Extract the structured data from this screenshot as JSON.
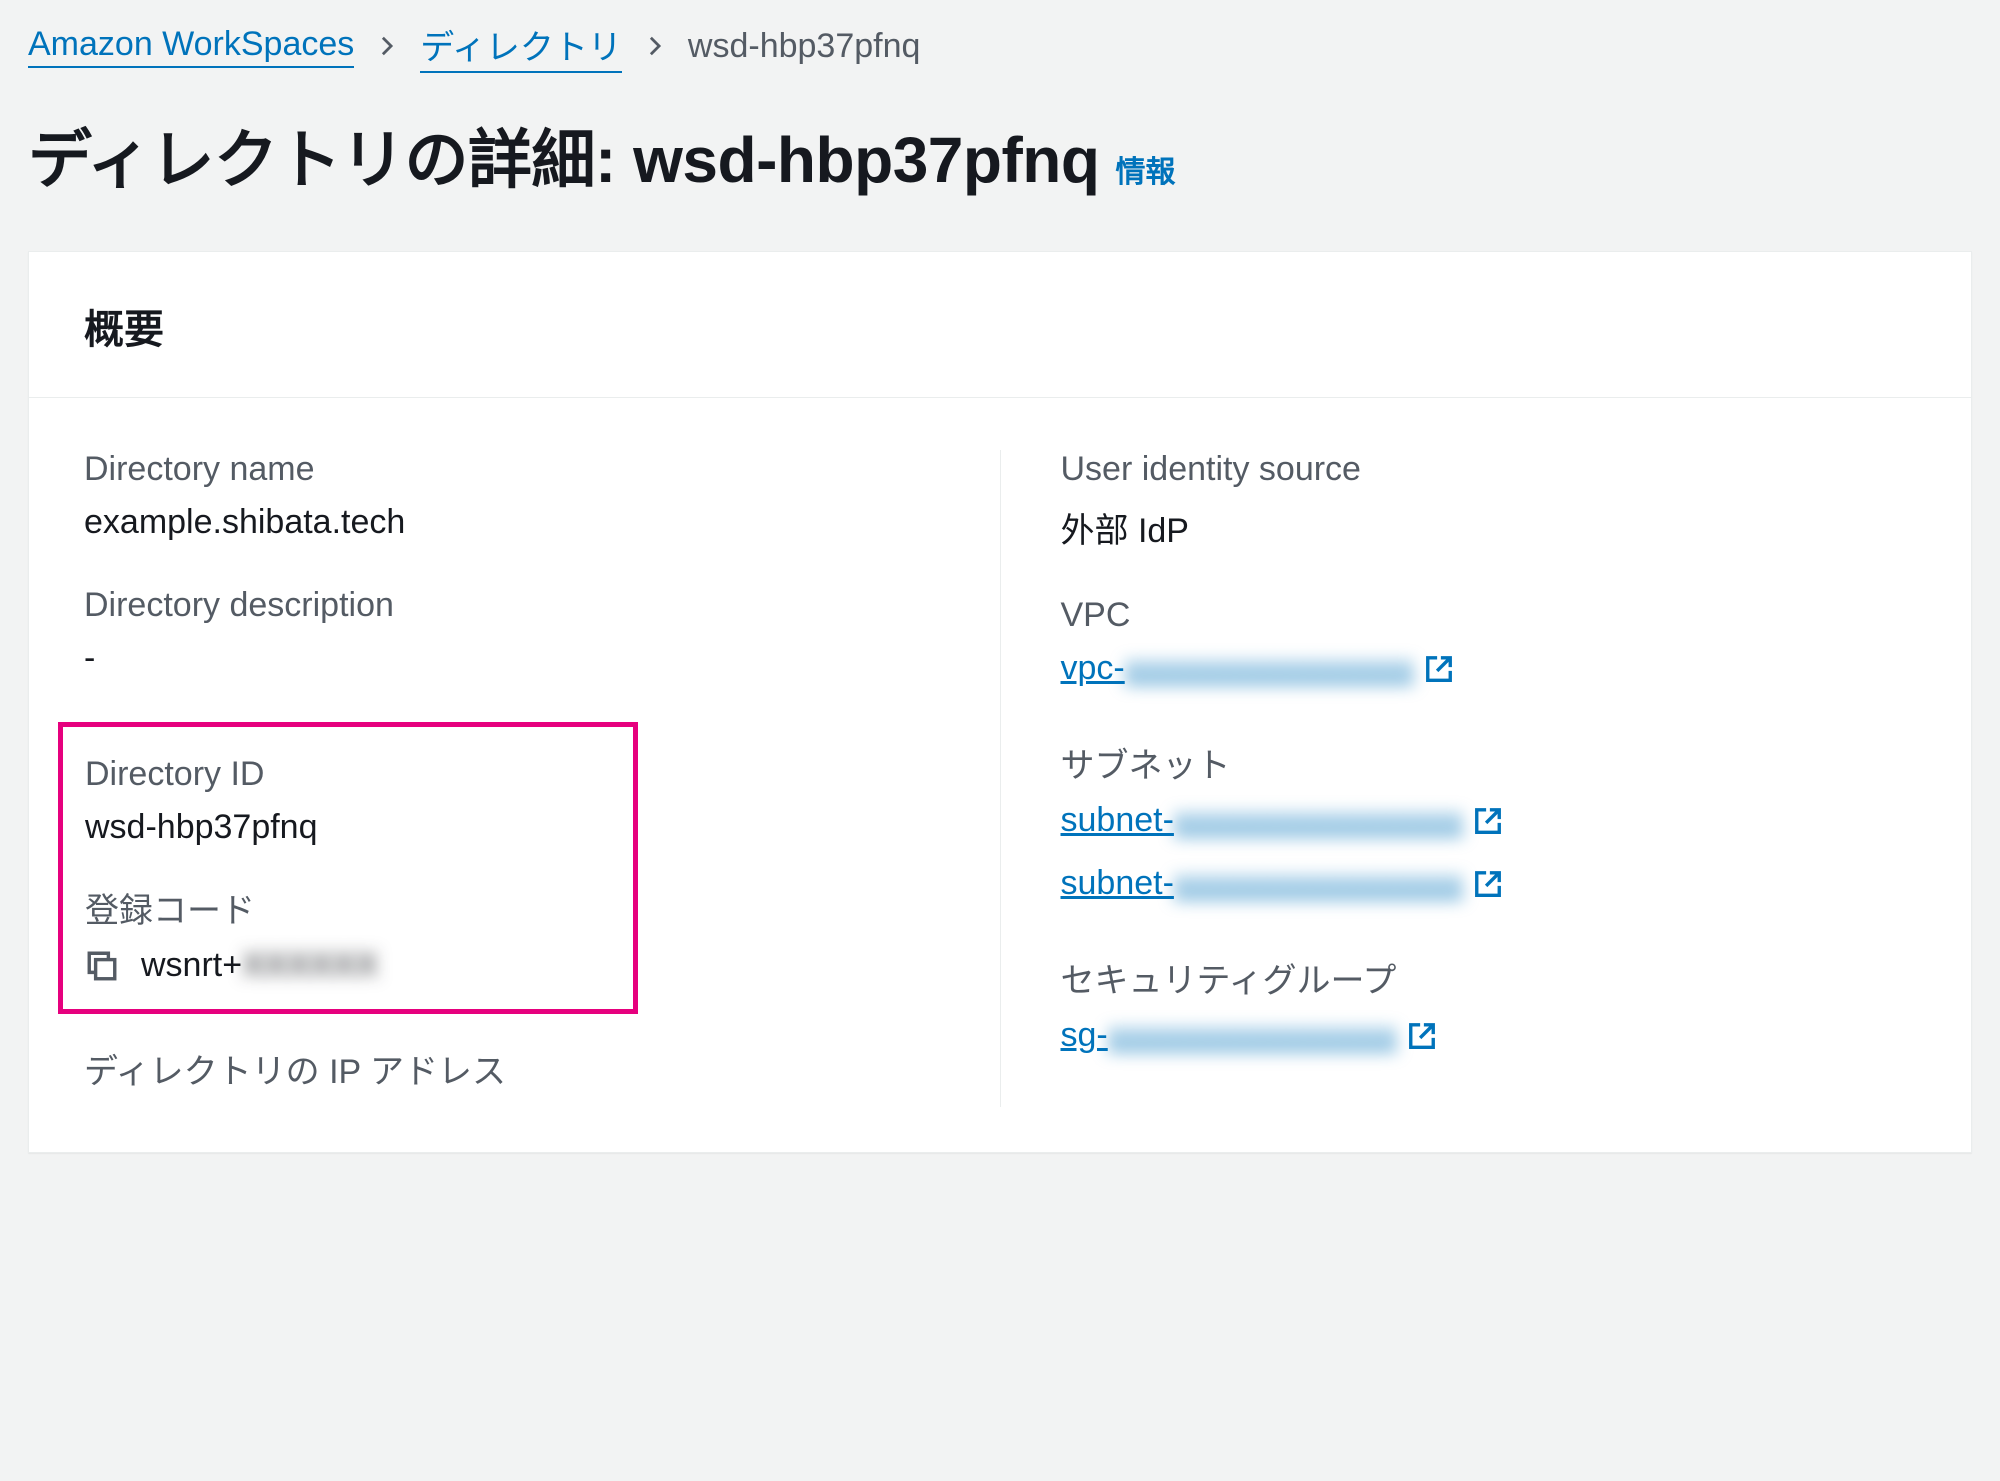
{
  "breadcrumb": {
    "root": "Amazon WorkSpaces",
    "level1": "ディレクトリ",
    "current": "wsd-hbp37pfnq"
  },
  "title": {
    "prefix": "ディレクトリの詳細: ",
    "id": "wsd-hbp37pfnq",
    "info": "情報"
  },
  "panel": {
    "heading": "概要"
  },
  "left": {
    "dir_name_label": "Directory name",
    "dir_name_value": "example.shibata.tech",
    "dir_desc_label": "Directory description",
    "dir_desc_value": "-",
    "dir_id_label": "Directory ID",
    "dir_id_value": "wsd-hbp37pfnq",
    "reg_code_label": "登録コード",
    "reg_code_prefix": "wsnrt+",
    "reg_code_hidden": "XXXXXX",
    "dir_ip_label": "ディレクトリの IP アドレス"
  },
  "right": {
    "uis_label": "User identity source",
    "uis_value": "外部 IdP",
    "vpc_label": "VPC",
    "vpc_prefix": "vpc-",
    "vpc_hidden": "xxxxxxxxxxxxxxxxx",
    "subnet_label": "サブネット",
    "subnet1_prefix": "subnet-",
    "subnet1_hidden": "xxxxxxxxxxxxxxxxx",
    "subnet2_prefix": "subnet-",
    "subnet2_hidden": "xxxxxxxxxxxxxxxxx",
    "sg_label": "セキュリティグループ",
    "sg_prefix": "sg-",
    "sg_hidden": "xxxxxxxxxxxxxxxxx"
  }
}
